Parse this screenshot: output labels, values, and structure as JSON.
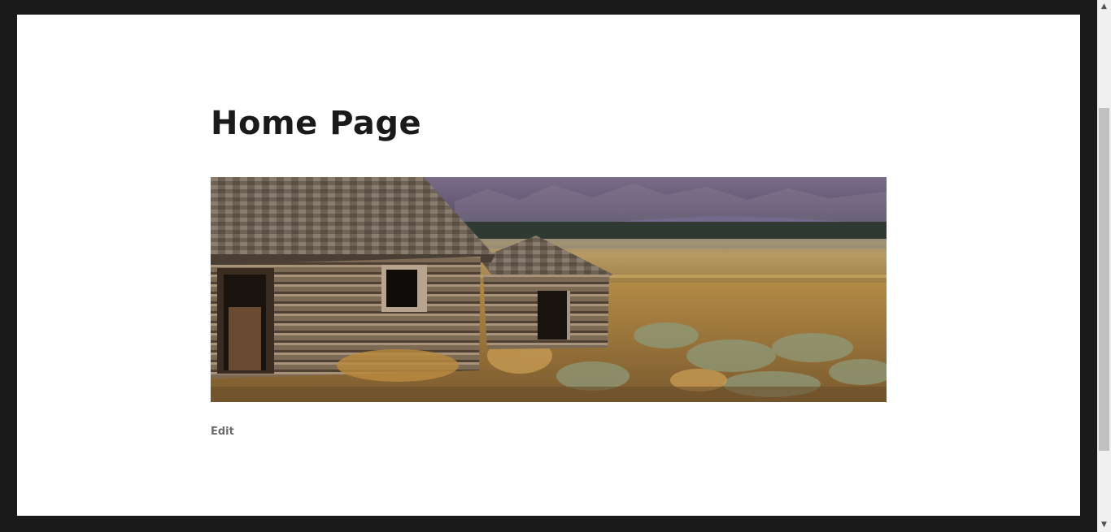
{
  "page": {
    "title": "Home Page",
    "edit_label": "Edit"
  },
  "hero_image": {
    "alt": "Old wooden cabins on a prairie with mountains in the background"
  },
  "scrollbar": {
    "up_icon": "▲",
    "down_icon": "▼"
  },
  "colors": {
    "outer_background": "#1a1a1a",
    "content_background": "#ffffff",
    "title_text": "#1a1a1a",
    "edit_text": "#6b6b6b"
  }
}
